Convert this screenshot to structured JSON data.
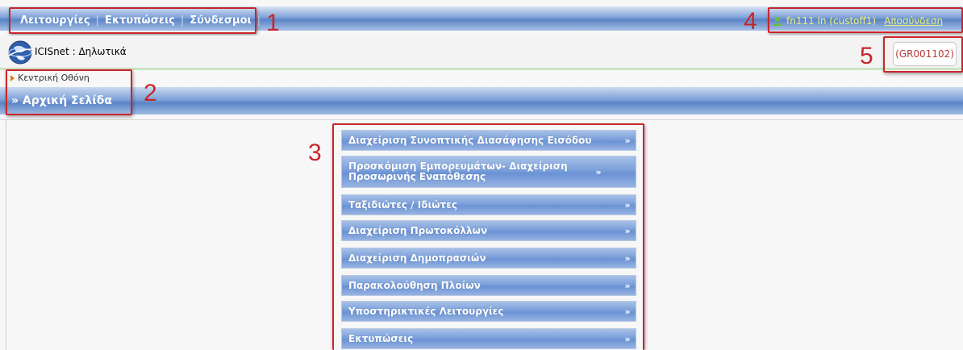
{
  "menu": {
    "items": [
      "Λειτουργίες",
      "Εκτυπώσεις",
      "Σύνδεσμοι"
    ]
  },
  "user": {
    "name": "fn111 ln (custoff1)",
    "logout": "Αποσύνδεση",
    "icon": "user-icon"
  },
  "app": {
    "title": "ICISnet : Δηλωτικά",
    "logo_icon": "globe-icon",
    "office_code": "(GR001102)"
  },
  "breadcrumb": {
    "text": "Κεντρική Οθόνη"
  },
  "page": {
    "title": "» Αρχική Σελίδα"
  },
  "accordion": {
    "items": [
      "Διαχείριση Συνοπτικής Διασάφησης Εισόδου",
      "Προσκόμιση Εμπορευμάτων- Διαχείριση Προσωρινής Εναπόθεσης",
      "Ταξιδιώτες / Ιδιώτες",
      "Διαχείριση Πρωτοκόλλων",
      "Διαχείριση Δημοπρασιών",
      "Παρακολούθηση Πλοίων",
      "Υποστηρικτικές Λειτουργίες",
      "Εκτυπώσεις"
    ],
    "chevron_icon": "double-chevron-down-icon"
  },
  "annotations": [
    "1",
    "2",
    "3",
    "4",
    "5"
  ],
  "colors": {
    "annotation": "#c8262b",
    "bar_blue": "#5b84c6",
    "user_text": "#e6f07a",
    "office_code": "#b33b3b"
  }
}
